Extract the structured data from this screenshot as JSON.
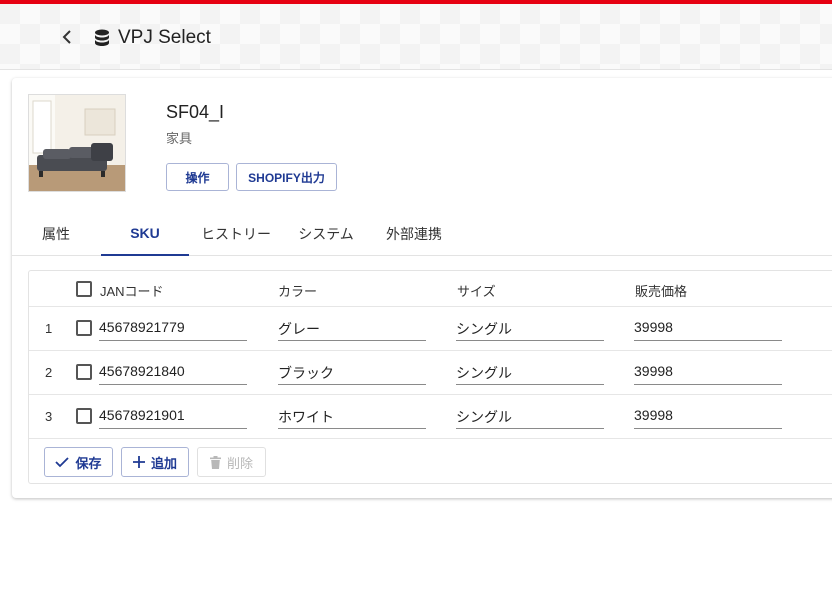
{
  "app": {
    "title": "VPJ Select"
  },
  "product": {
    "name": "SF04_I",
    "category": "家具"
  },
  "actions": {
    "operate": "操作",
    "shopify_export": "SHOPIFY出力"
  },
  "tabs": [
    {
      "label": "属性"
    },
    {
      "label": "SKU"
    },
    {
      "label": "ヒストリー"
    },
    {
      "label": "システム"
    },
    {
      "label": "外部連携"
    }
  ],
  "table": {
    "headers": {
      "jan": "JANコード",
      "color": "カラー",
      "size": "サイズ",
      "price": "販売価格"
    },
    "rows": [
      {
        "num": "1",
        "jan": "45678921779",
        "color": "グレー",
        "size": "シングル",
        "price": "39998"
      },
      {
        "num": "2",
        "jan": "45678921840",
        "color": "ブラック",
        "size": "シングル",
        "price": "39998"
      },
      {
        "num": "3",
        "jan": "45678921901",
        "color": "ホワイト",
        "size": "シングル",
        "price": "39998"
      }
    ]
  },
  "buttons": {
    "save": "保存",
    "add": "追加",
    "delete": "削除"
  },
  "colors": {
    "accent": "#1f3a93",
    "brand_red": "#e60012"
  }
}
